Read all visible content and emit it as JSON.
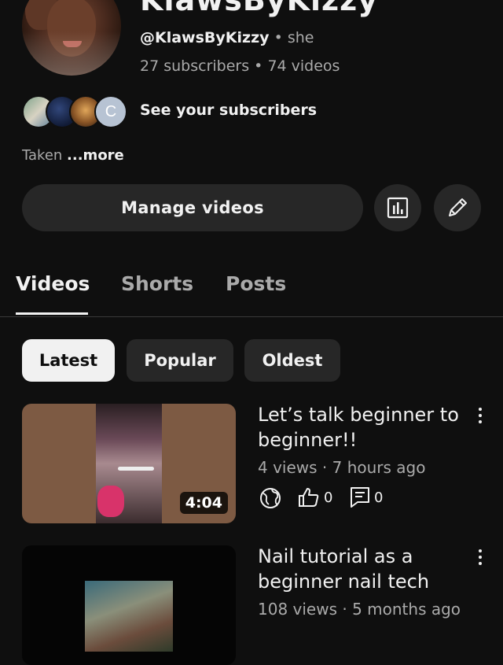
{
  "channel": {
    "name": "KlawsByKizzy",
    "handle": "@KlawsByKizzy",
    "separator": "•",
    "pronouns": "she",
    "subscribers": "27 subscribers",
    "videos_count": "74 videos",
    "see_subscribers": "See your subscribers",
    "subscriber_avatar_initial": "C",
    "description": "Taken",
    "more": "...more"
  },
  "actions": {
    "manage_videos": "Manage videos",
    "analytics_icon": "bar-chart-icon",
    "edit_icon": "pencil-icon"
  },
  "tabs": [
    {
      "label": "Videos",
      "active": true
    },
    {
      "label": "Shorts",
      "active": false
    },
    {
      "label": "Posts",
      "active": false
    }
  ],
  "filters": [
    {
      "label": "Latest",
      "active": true
    },
    {
      "label": "Popular",
      "active": false
    },
    {
      "label": "Oldest",
      "active": false
    }
  ],
  "videos": [
    {
      "title": "Let’s talk beginner to beginner!!",
      "views": "4 views",
      "age": "7 hours ago",
      "meta": "4 views · 7 hours ago",
      "duration": "4:04",
      "likes": "0",
      "comments": "0",
      "visibility_icon": "globe-icon"
    },
    {
      "title": "Nail tutorial as a beginner nail tech",
      "views": "108 views",
      "age": "5 months ago",
      "meta": "108 views · 5 months ago"
    }
  ],
  "colors": {
    "background": "#0f0f0f",
    "surface": "#272727",
    "text_primary": "#f1f1f1",
    "text_secondary": "#aaaaaa"
  }
}
